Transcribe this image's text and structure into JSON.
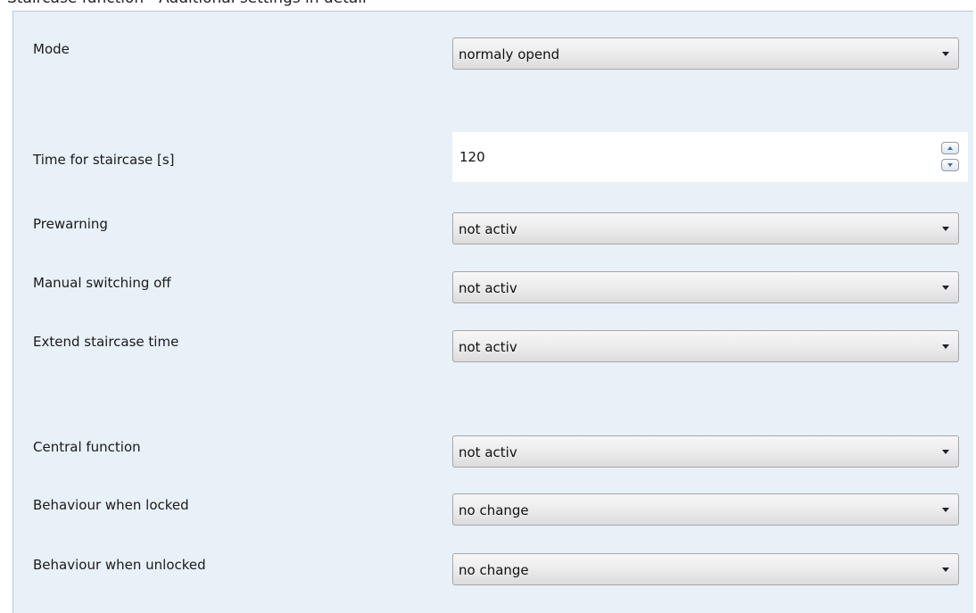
{
  "caption": "Staircase function - Additional settings in detail",
  "rows": [
    {
      "label": "Mode",
      "value": "normaly opend"
    },
    {
      "label": "Time for staircase [s]",
      "value": "120"
    },
    {
      "label": "Prewarning",
      "value": "not activ"
    },
    {
      "label": "Manual switching off",
      "value": "not activ"
    },
    {
      "label": "Extend staircase time",
      "value": "not activ"
    },
    {
      "label": "Central function",
      "value": "not activ"
    },
    {
      "label": "Behaviour when locked",
      "value": "no change"
    },
    {
      "label": "Behaviour when unlocked",
      "value": "no change"
    }
  ],
  "icons": {
    "dropdown": "chevron-down-icon",
    "spin_up": "arrow-up-icon",
    "spin_down": "arrow-down-icon"
  },
  "colors": {
    "panel_background": "#e8f0f8",
    "spin_arrow": "#3b6fb0"
  }
}
